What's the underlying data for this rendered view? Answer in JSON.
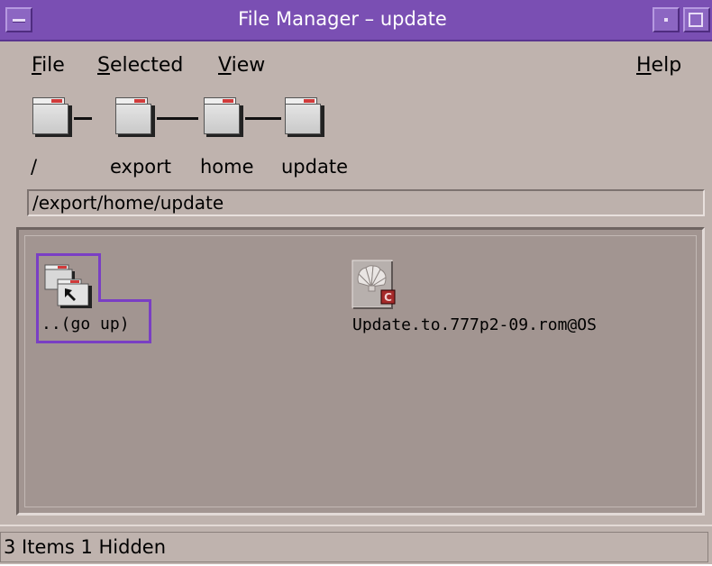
{
  "window": {
    "title": "File Manager – update",
    "accent": "#7a4fb3"
  },
  "menubar": {
    "file": {
      "mnemonic": "F",
      "rest": "ile"
    },
    "selected": {
      "mnemonic": "S",
      "rest": "elected"
    },
    "view": {
      "mnemonic": "V",
      "rest": "iew"
    },
    "help": {
      "mnemonic": "H",
      "rest": "elp"
    }
  },
  "path_bar": {
    "segments": [
      {
        "label": "/",
        "icon": "folder-icon"
      },
      {
        "label": "export",
        "icon": "folder-icon"
      },
      {
        "label": "home",
        "icon": "folder-icon"
      },
      {
        "label": "update",
        "icon": "folder-icon"
      }
    ]
  },
  "path_field": {
    "value": "/export/home/update"
  },
  "files": [
    {
      "name": "..(go up)",
      "icon": "go-up-folder-icon",
      "selected": true
    },
    {
      "name": "Update.to.777p2-09.rom@OS",
      "icon": "shell-file-icon",
      "selected": false
    }
  ],
  "status": {
    "text": "3 Items 1 Hidden"
  }
}
